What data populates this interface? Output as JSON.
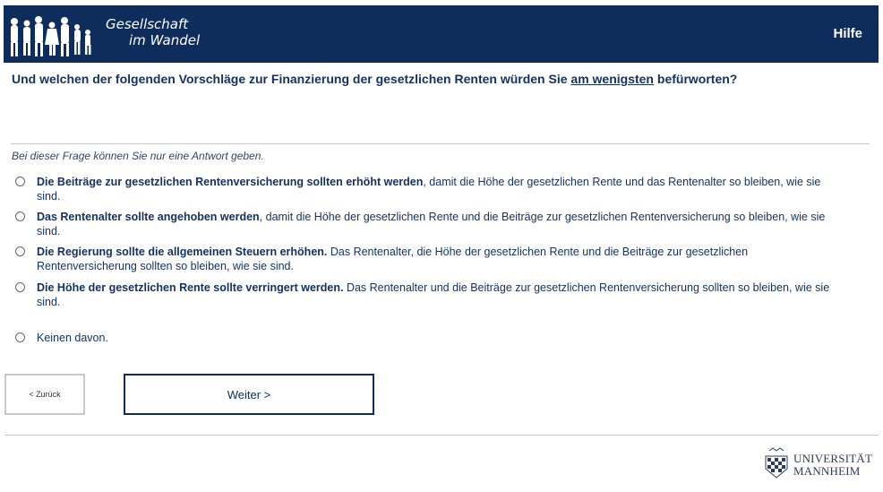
{
  "header": {
    "logo_line1": "Gesellschaft",
    "logo_line2": "im Wandel",
    "help_label": "Hilfe"
  },
  "question": {
    "text_before": "Und welchen der folgenden Vorschläge zur Finanzierung der gesetzlichen Renten würden Sie ",
    "emphasis": "am wenigsten",
    "text_after": " befürworten?"
  },
  "instruction": "Bei dieser Frage können Sie nur eine Antwort geben.",
  "options": [
    {
      "bold": "Die Beiträge zur gesetzlichen Rentenversicherung sollten erhöht werden",
      "rest": ", damit die Höhe der gesetzlichen Rente und das Rentenalter so bleiben, wie sie sind.",
      "selected": false
    },
    {
      "bold": "Das Rentenalter sollte angehoben werden",
      "rest": ", damit die Höhe der gesetzlichen Rente und die Beiträge zur gesetzlichen Rentenversicherung so bleiben, wie sie sind.",
      "selected": false
    },
    {
      "bold": "Die Regierung sollte die allgemeinen Steuern erhöhen.",
      "rest": " Das Rentenalter, die Höhe der gesetzlichen Rente und die Beiträge zur gesetzlichen Rentenversicherung sollten so bleiben, wie sie sind.",
      "selected": false
    },
    {
      "bold": "Die Höhe der gesetzlichen Rente sollte verringert werden.",
      "rest": " Das Rentenalter und die Beiträge zur gesetzlichen Rentenversicherung sollten so bleiben, wie sie sind.",
      "selected": false
    },
    {
      "bold": "",
      "rest": "Keinen davon.",
      "selected": false
    }
  ],
  "nav": {
    "back_label": "< Zurück",
    "next_label": "Weiter >"
  },
  "footer": {
    "uni_line1": "UNIVERSITÄT",
    "uni_line2": "MANNHEIM"
  },
  "colors": {
    "header_bg": "#0f2d5c",
    "text_primary": "#14305e",
    "button_border": "#0f2d5c"
  }
}
